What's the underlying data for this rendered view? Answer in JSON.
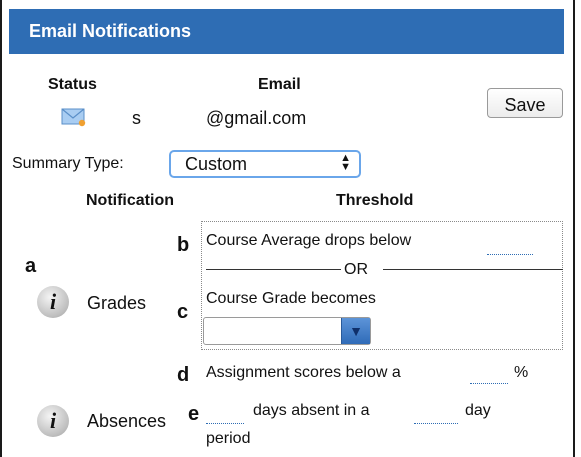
{
  "header": {
    "title": "Email Notifications"
  },
  "status": {
    "status_header": "Status",
    "email_header": "Email",
    "status_value": "s",
    "email_value": "@gmail.com",
    "save_label": "Save"
  },
  "summary": {
    "label": "Summary Type:",
    "value": "Custom"
  },
  "columns": {
    "notification": "Notification",
    "threshold": "Threshold"
  },
  "labels": {
    "a": "a",
    "b": "b",
    "c": "c",
    "d": "d",
    "e": "e"
  },
  "grades": {
    "name": "Grades",
    "course_average": "Course Average drops below",
    "or": "OR",
    "course_grade": "Course Grade becomes"
  },
  "assignment": {
    "text": "Assignment scores below a",
    "unit": "%"
  },
  "absences": {
    "name": "Absences",
    "text1": "days absent in a",
    "text2": "day",
    "text3": "period"
  },
  "icons": {
    "info": "info-icon",
    "mail": "mail-icon",
    "dropdown": "dropdown-arrow-icon"
  },
  "colors": {
    "header_bg": "#2e6db4",
    "focus_border": "#6aa6ea"
  }
}
